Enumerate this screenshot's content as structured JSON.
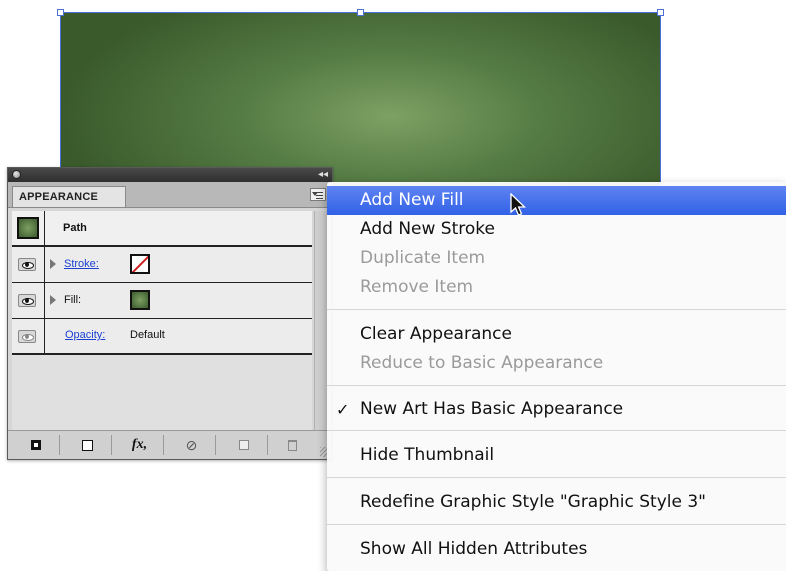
{
  "canvas": {
    "shape_fill_colors": [
      "#7da064",
      "#567c45",
      "#3a5a2b"
    ],
    "selection_color": "#4a6fd6"
  },
  "panel": {
    "tab_label": "APPEARANCE",
    "rows": {
      "path_label": "Path",
      "stroke_label": "Stroke:",
      "fill_label": "Fill:",
      "opacity_label": "Opacity:",
      "opacity_value": "Default"
    },
    "bottom_buttons": [
      "add-stroke-icon",
      "add-fill-icon",
      "fx-icon",
      "clear-icon",
      "duplicate-icon",
      "trash-icon"
    ],
    "fx_label": "fx,",
    "clear_glyph": "⊘"
  },
  "menu": {
    "items": [
      {
        "label": "Add New Fill",
        "state": "highlighted"
      },
      {
        "label": "Add New Stroke",
        "state": "enabled"
      },
      {
        "label": "Duplicate Item",
        "state": "disabled"
      },
      {
        "label": "Remove Item",
        "state": "disabled"
      },
      {
        "label": "Clear Appearance",
        "state": "enabled"
      },
      {
        "label": "Reduce to Basic Appearance",
        "state": "disabled"
      },
      {
        "label": "New Art Has Basic Appearance",
        "state": "checked"
      },
      {
        "label": "Hide Thumbnail",
        "state": "enabled"
      },
      {
        "label": "Redefine Graphic Style \"Graphic Style 3\"",
        "state": "enabled"
      },
      {
        "label": "Show All Hidden Attributes",
        "state": "enabled"
      }
    ],
    "checkmark": "✓",
    "highlight_color": "#3161e6"
  }
}
